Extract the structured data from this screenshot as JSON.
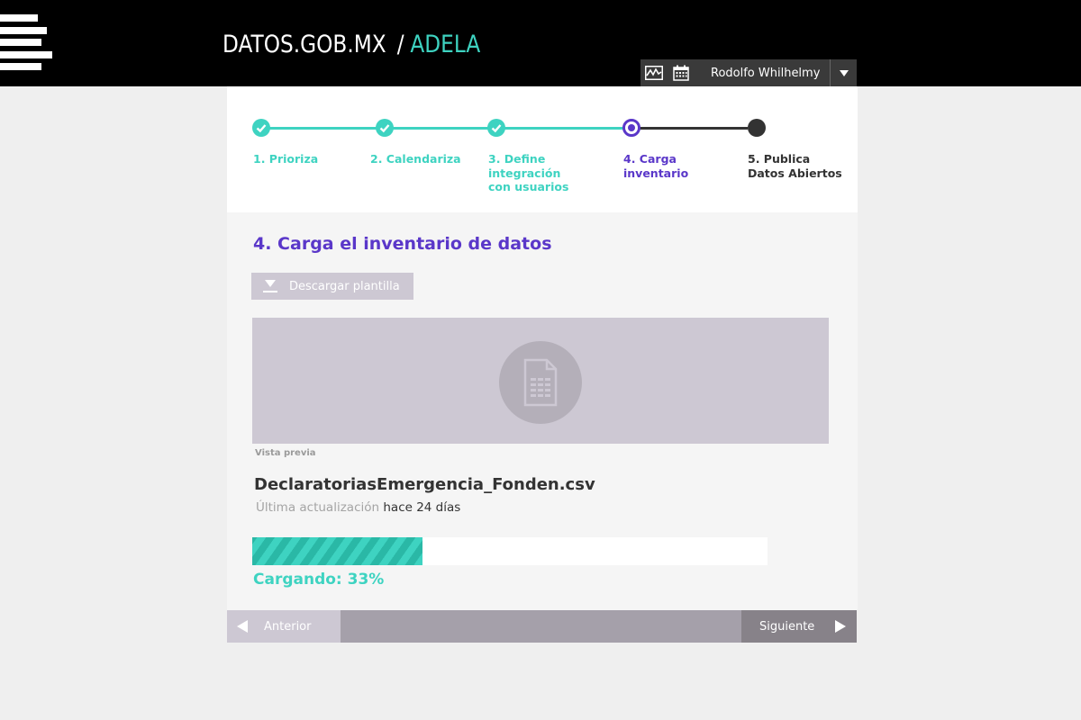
{
  "header": {
    "brand": "DATOS.GOB.MX",
    "separator": "/",
    "app": "ADELA",
    "icons": [
      "menu-icon",
      "activity-chart-icon",
      "calendar-icon",
      "chevron-down-icon"
    ],
    "user_name": "Rodolfo Whilhelmy"
  },
  "stepper": {
    "steps": [
      {
        "label": "1. Prioriza",
        "state": "done"
      },
      {
        "label": "2. Calendariza",
        "state": "done"
      },
      {
        "label": "3. Define integración con usuarios",
        "state": "done"
      },
      {
        "label": "4. Carga inventario",
        "state": "current"
      },
      {
        "label": "5. Publica Datos Abiertos",
        "state": "todo"
      }
    ]
  },
  "main": {
    "title": "4. Carga el inventario de datos",
    "download_label": "Descargar plantilla",
    "preview_caption": "Vista previa",
    "file_name": "DeclaratoriasEmergencia_Fonden.csv",
    "updated_label": "Última actualización",
    "updated_value": "hace 24 días",
    "progress_text": "Cargando: 33%",
    "progress_fraction": 0.33
  },
  "footer": {
    "prev_label": "Anterior",
    "next_label": "Siguiente"
  },
  "colors": {
    "accent_teal": "#3ed3c1",
    "accent_purple": "#5a37c9",
    "dark": "#333333"
  }
}
